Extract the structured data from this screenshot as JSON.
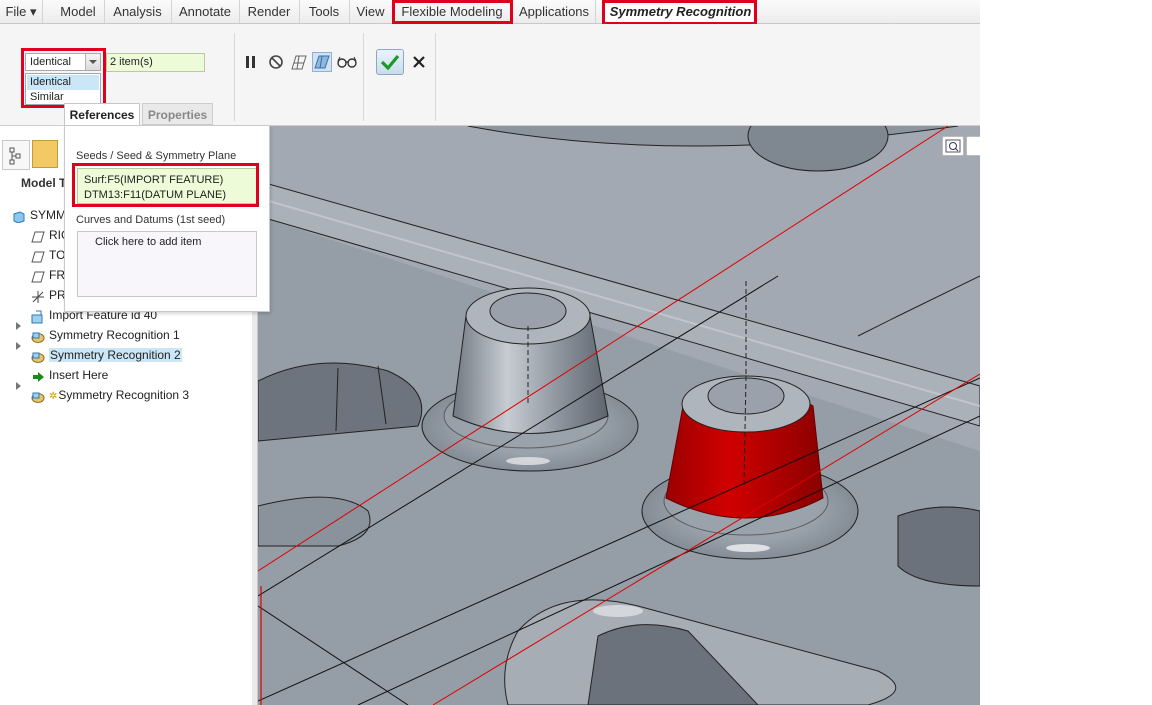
{
  "menu": {
    "file": "File ▾",
    "tabs": [
      "Model",
      "Analysis",
      "Annotate",
      "Render",
      "Tools",
      "View",
      "Flexible Modeling",
      "Applications"
    ],
    "active_tab": "Symmetry Recognition"
  },
  "ribbon": {
    "mode_combo": "Identical",
    "mode_options": [
      "Identical",
      "Similar"
    ],
    "items_count": "2 item(s)",
    "tools": [
      "pause-icon",
      "no-entry-icon",
      "preview-wireframe-icon",
      "preview-shaded-icon",
      "glasses-icon",
      "confirm-check-icon",
      "cancel-x-icon"
    ],
    "subtabs": [
      "References",
      "Properties"
    ]
  },
  "references": {
    "seeds_label": "Seeds / Seed & Symmetry Plane",
    "seeds": [
      "Surf:F5(IMPORT FEATURE)",
      "DTM13:F11(DATUM PLANE)"
    ],
    "curves_label": "Curves and Datums (1st seed)",
    "curves_placeholder": "Click here to add item"
  },
  "model_tree": {
    "title": "Model T",
    "root": "SYMME",
    "items": [
      {
        "label": "RIG",
        "icon": "datum-plane-icon"
      },
      {
        "label": "TO",
        "icon": "datum-plane-icon"
      },
      {
        "label": "FR",
        "icon": "datum-plane-icon"
      },
      {
        "label": "PR",
        "icon": "csys-icon"
      },
      {
        "label": "Import Feature id 40",
        "icon": "import-feature-icon"
      },
      {
        "label": "Symmetry Recognition 1",
        "icon": "symmetry-feature-icon",
        "expandable": true
      },
      {
        "label": "Symmetry Recognition 2",
        "icon": "symmetry-feature-icon",
        "expandable": true,
        "selected": true
      },
      {
        "label": "Insert Here",
        "icon": "insert-arrow-icon"
      },
      {
        "label": "Symmetry Recognition 3",
        "icon": "symmetry-feature-icon",
        "expandable": true
      }
    ]
  },
  "colors": {
    "highlight_red": "#e0001b",
    "selected_surface": "#c40000",
    "viewport_bg": "#929aa4",
    "tree_selection": "#cbe6f7",
    "collector_bg": "#eefbd8"
  }
}
